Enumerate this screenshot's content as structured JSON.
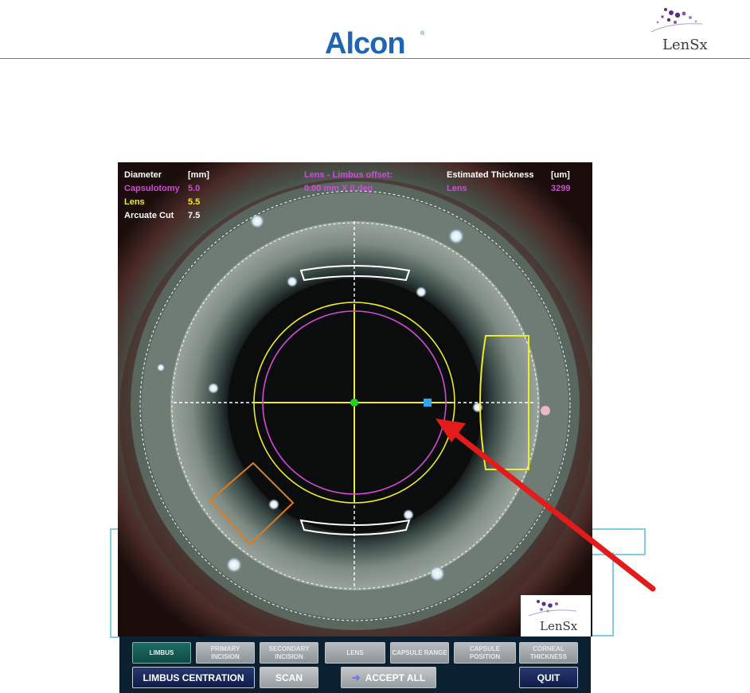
{
  "header": {
    "brand": "Alcon",
    "brand_registered": "®",
    "partner_logo": "LenSx"
  },
  "overlay": {
    "diameter_header": "Diameter",
    "diameter_unit": "[mm]",
    "rows": [
      {
        "label": "Capsulotomy",
        "value": "5.0",
        "color": "#d24ad8"
      },
      {
        "label": "Lens",
        "value": "5.5",
        "color": "#ecec2a"
      },
      {
        "label": "Arcuate Cut",
        "value": "7.5",
        "color": "#ffffff"
      }
    ],
    "offset_title": "Lens - Limbus offset:",
    "offset_value": "0.00 mm X 0 deg",
    "thickness_header": "Estimated Thickness",
    "thickness_unit": "[um]",
    "thickness_label": "Lens",
    "thickness_value": "3299"
  },
  "watermark": "LenSx",
  "toolbar": {
    "top_buttons": [
      {
        "label": "LIMBUS",
        "active": true
      },
      {
        "label": "PRIMARY INCISION",
        "active": false
      },
      {
        "label": "SECONDARY INCISION",
        "active": false
      },
      {
        "label": "LENS",
        "active": false
      },
      {
        "label": "CAPSULE RANGE",
        "active": false
      },
      {
        "label": "CAPSULE POSITION",
        "active": false
      },
      {
        "label": "CORNEAL THICKNESS",
        "active": false
      }
    ],
    "limbus_centration": "LIMBUS CENTRATION",
    "scan": "SCAN",
    "accept_all": "ACCEPT ALL",
    "quit": "QUIT"
  },
  "colors": {
    "capsulotomy": "#d24ad8",
    "lens": "#ecec2a",
    "arcuate": "#ffffff",
    "incision": "#e07a1a",
    "annotation_arrow": "#e21b1b",
    "bracket": "#86cbe0",
    "alcon_blue": "#1f66b2",
    "lensx_purple": "#5b2d86"
  }
}
